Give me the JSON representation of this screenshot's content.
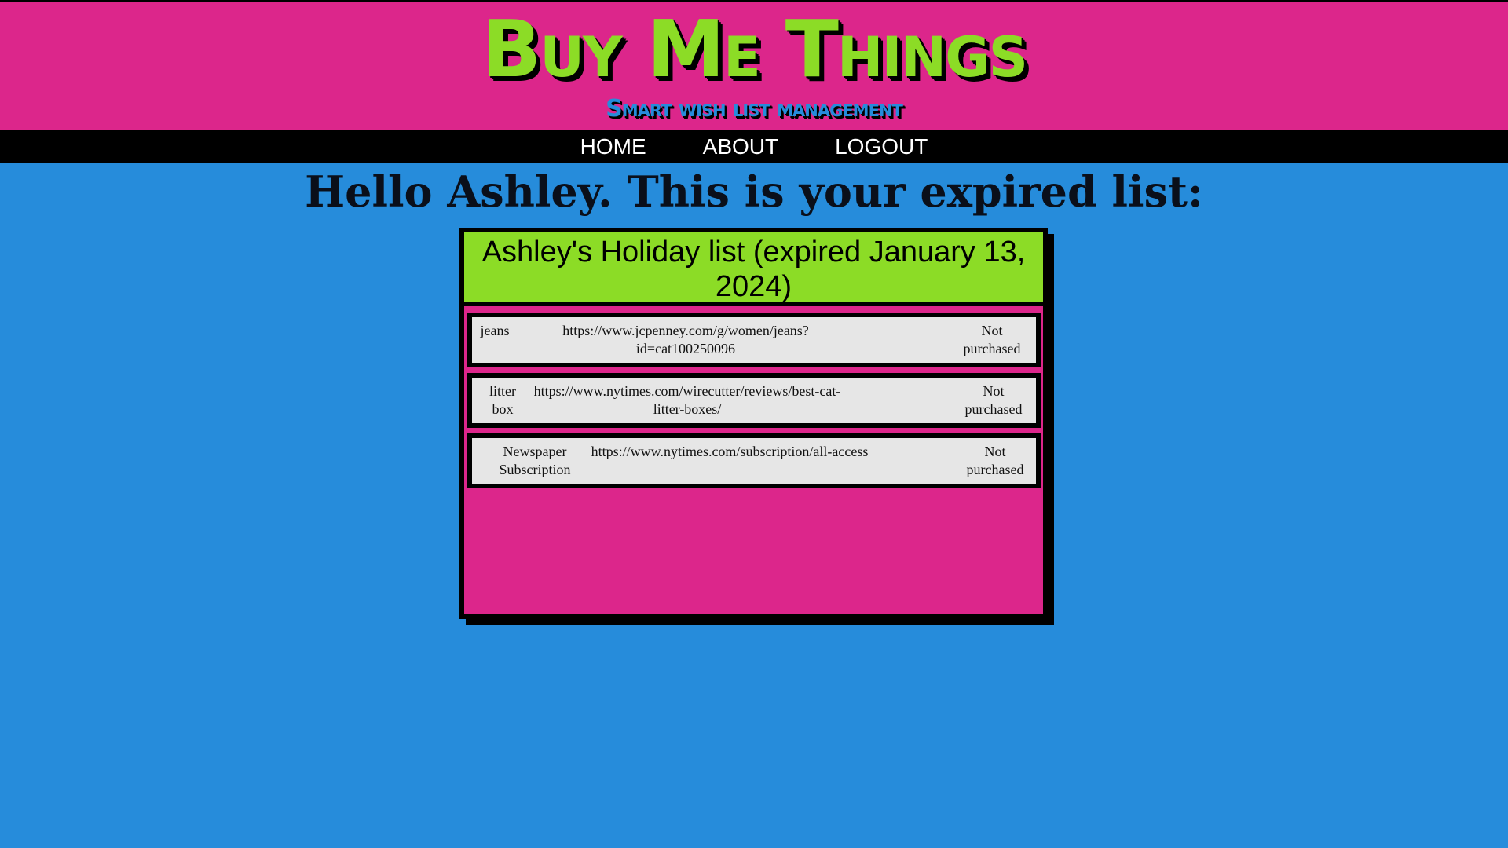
{
  "site": {
    "title": "Buy Me Things",
    "tagline": "Smart wish list management"
  },
  "nav": {
    "home": "HOME",
    "about": "ABOUT",
    "logout": "LOGOUT"
  },
  "heading": "Hello Ashley. This is your expired list:",
  "list": {
    "title": "Ashley's Holiday list (expired January 13, 2024)",
    "items": [
      {
        "name": "jeans",
        "url": "https://www.jcpenney.com/g/women/jeans?id=cat100250096",
        "status": "Not purchased"
      },
      {
        "name": "litter box",
        "url": "https://www.nytimes.com/wirecutter/reviews/best-cat-litter-boxes/",
        "status": "Not purchased"
      },
      {
        "name": "Newspaper Subscription",
        "url": "https://www.nytimes.com/subscription/all-access",
        "status": "Not purchased"
      }
    ]
  },
  "colors": {
    "background": "#268cdb",
    "header": "#dc268b",
    "accent_green": "#8cdc26",
    "row_bg": "#e6e6e6"
  }
}
